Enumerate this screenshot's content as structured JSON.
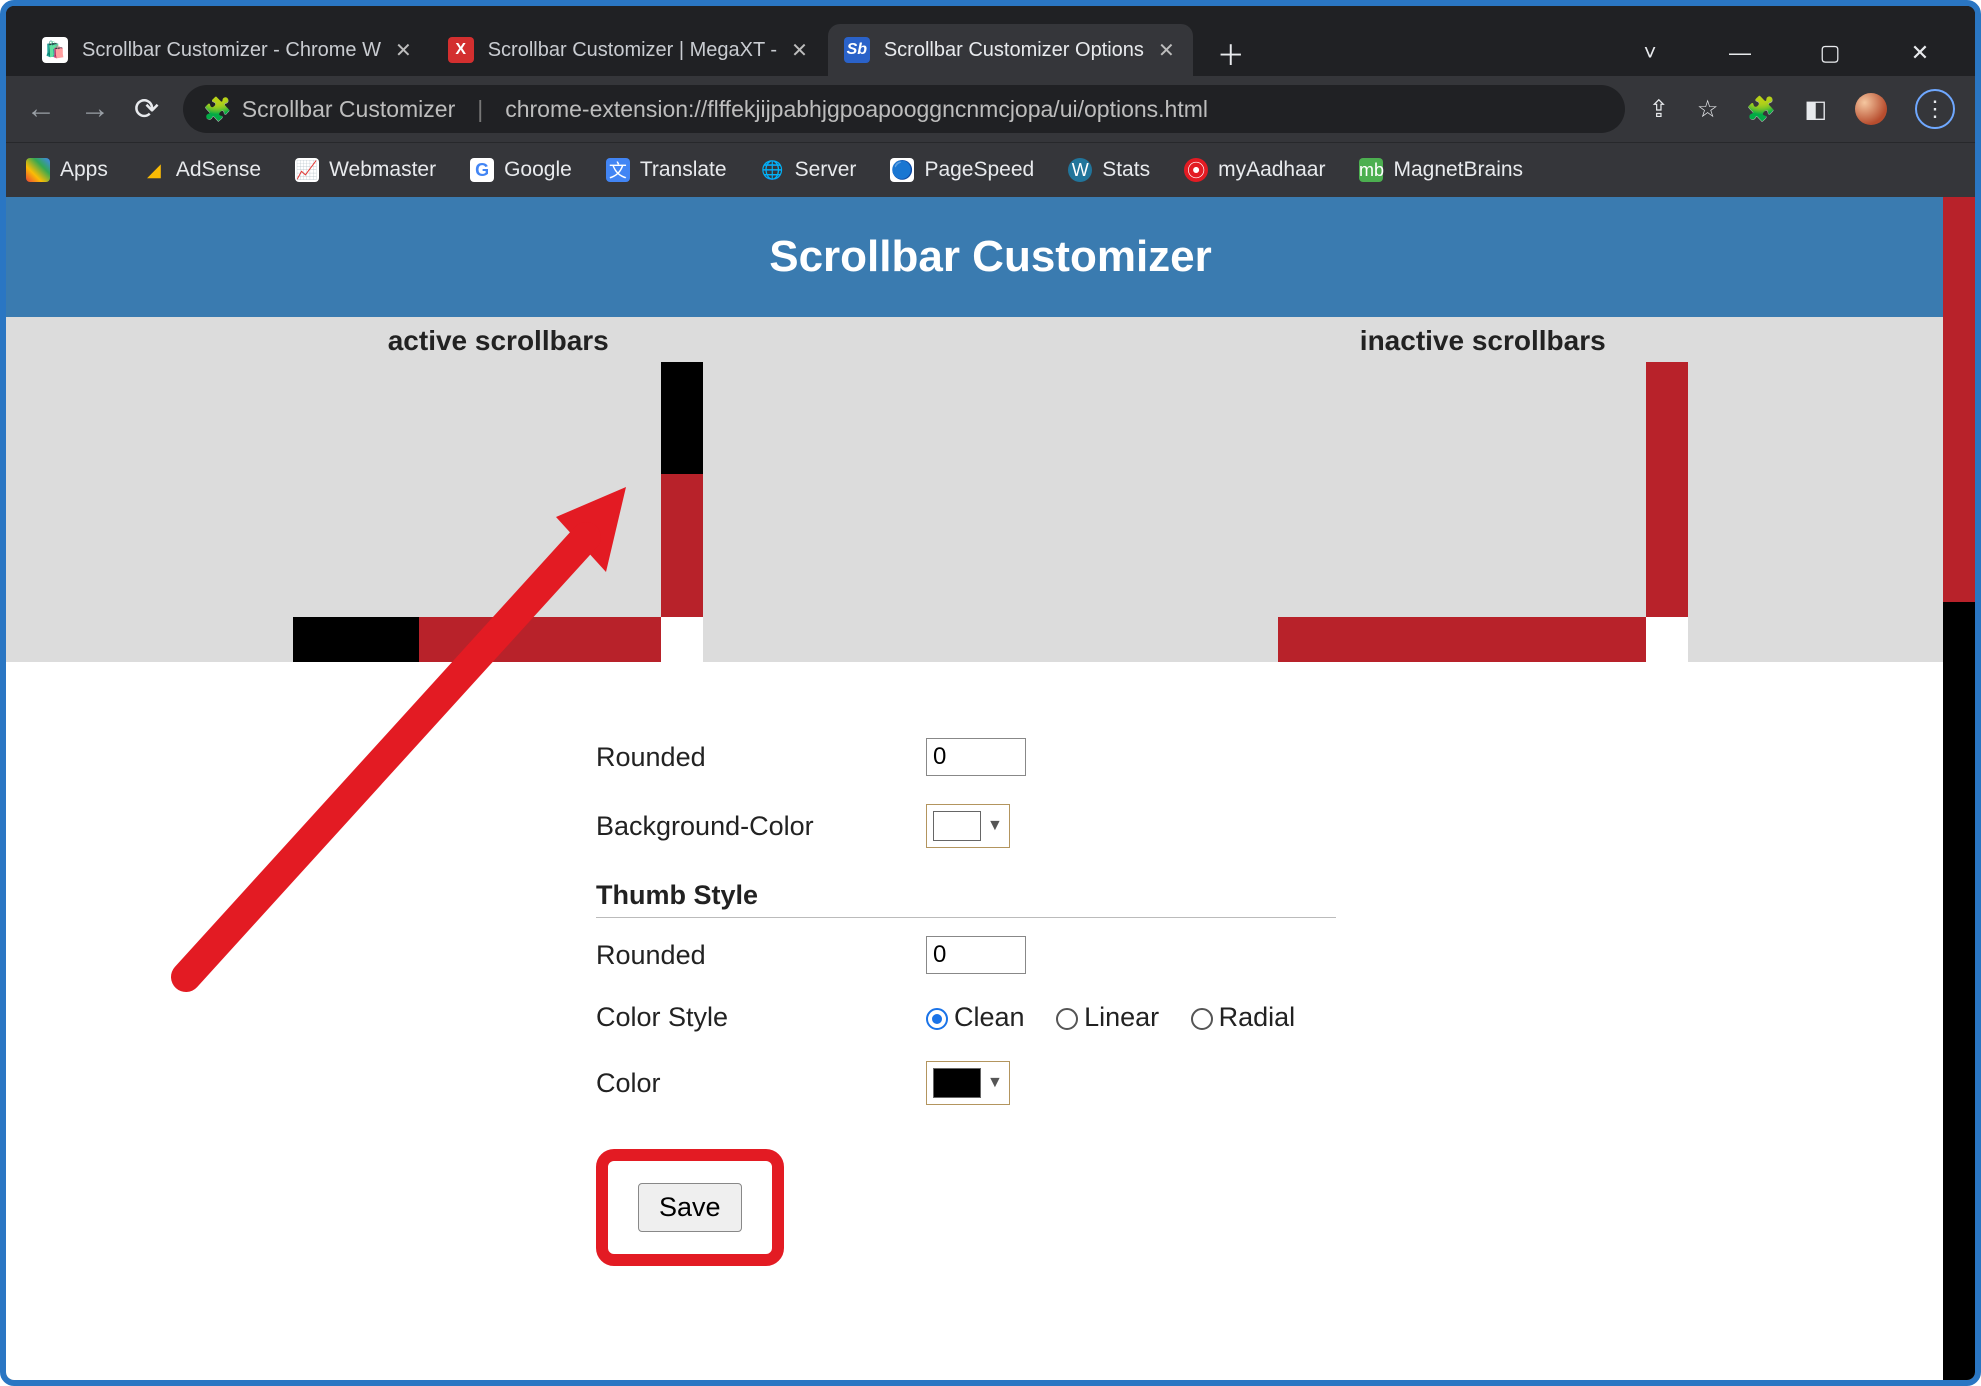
{
  "tabs": [
    {
      "title": "Scrollbar Customizer - Chrome W",
      "favicon": "🏬"
    },
    {
      "title": "Scrollbar Customizer | MegaXT - ",
      "favicon": "X"
    },
    {
      "title": "Scrollbar Customizer Options",
      "favicon": "Sb"
    }
  ],
  "omnibox": {
    "ext_label": "Scrollbar Customizer",
    "url": "chrome-extension://flffekjijpabhjgpoapooggncnmcjopa/ui/options.html"
  },
  "bookmarks": [
    {
      "label": "Apps"
    },
    {
      "label": "AdSense"
    },
    {
      "label": "Webmaster"
    },
    {
      "label": "Google"
    },
    {
      "label": "Translate"
    },
    {
      "label": "Server"
    },
    {
      "label": "PageSpeed"
    },
    {
      "label": "Stats"
    },
    {
      "label": "myAadhaar"
    },
    {
      "label": "MagnetBrains"
    }
  ],
  "page": {
    "title": "Scrollbar Customizer",
    "demo": {
      "active_label": "active scrollbars",
      "inactive_label": "inactive scrollbars"
    },
    "form": {
      "rounded1_label": "Rounded",
      "rounded1_value": "0",
      "bgcolor_label": "Background-Color",
      "bgcolor_value": "#ffffff",
      "section_thumb": "Thumb Style",
      "rounded2_label": "Rounded",
      "rounded2_value": "0",
      "colorstyle_label": "Color Style",
      "colorstyle_options": {
        "clean": "Clean",
        "linear": "Linear",
        "radial": "Radial"
      },
      "color_label": "Color",
      "color_value": "#000000",
      "save": "Save"
    }
  },
  "colors": {
    "header": "#3a7bb0",
    "demo_track": "#b8222a",
    "demo_thumb": "#000000",
    "arrow": "#e31b23"
  }
}
